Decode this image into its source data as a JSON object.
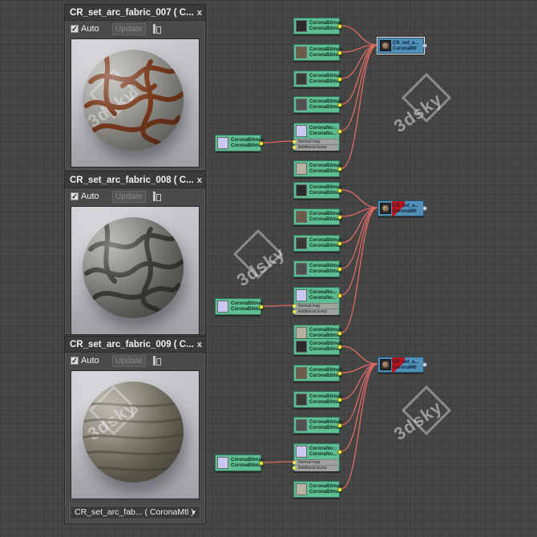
{
  "panels": [
    {
      "title": "CR_set_arc_fabric_007 ( C...",
      "close": "x",
      "auto_label": "Auto",
      "auto_check": "✓",
      "update_label": "Update",
      "sphere": {
        "base": "#8c8a84",
        "pattern": "#7a3a1c"
      }
    },
    {
      "title": "CR_set_arc_fabric_008 ( C...",
      "close": "x",
      "auto_label": "Auto",
      "auto_check": "✓",
      "update_label": "Update",
      "sphere": {
        "base": "#6f6e68",
        "pattern": "#3c3c38"
      }
    },
    {
      "title": "CR_set_arc_fabric_009 ( C...",
      "close": "x",
      "auto_label": "Auto",
      "auto_check": "✓",
      "update_label": "Update",
      "sphere": {
        "base": "#6e6a5a",
        "pattern": "#5a5748"
      },
      "dropdown": "CR_set_arc_fab... ( CoronaMtl )",
      "dropdown_arrow": "▾"
    }
  ],
  "bitmap_node": {
    "line1": "CoronaBitmap",
    "line2": "CoronaBitmap"
  },
  "normal_node": {
    "line1": "CoronaNo...",
    "line2": "CoronaNo...",
    "menu": "...",
    "slot1": "Normal map",
    "slot2": "Additional bump"
  },
  "material_nodes": [
    {
      "line1": "CR_set_a...",
      "line2": "CoronaMtl"
    },
    {
      "line1": "CR_set_a...",
      "line2": "CoronaMtl"
    },
    {
      "line1": "CR_set_a...",
      "line2": "CoronaMtl"
    }
  ],
  "colors": {
    "bitmap_node": "#5ebd93",
    "material_node": "#4f8fb8",
    "wire": "#e06a64",
    "port": "#f1ee44",
    "selected": "#c1121a"
  },
  "watermark": "3dsky"
}
